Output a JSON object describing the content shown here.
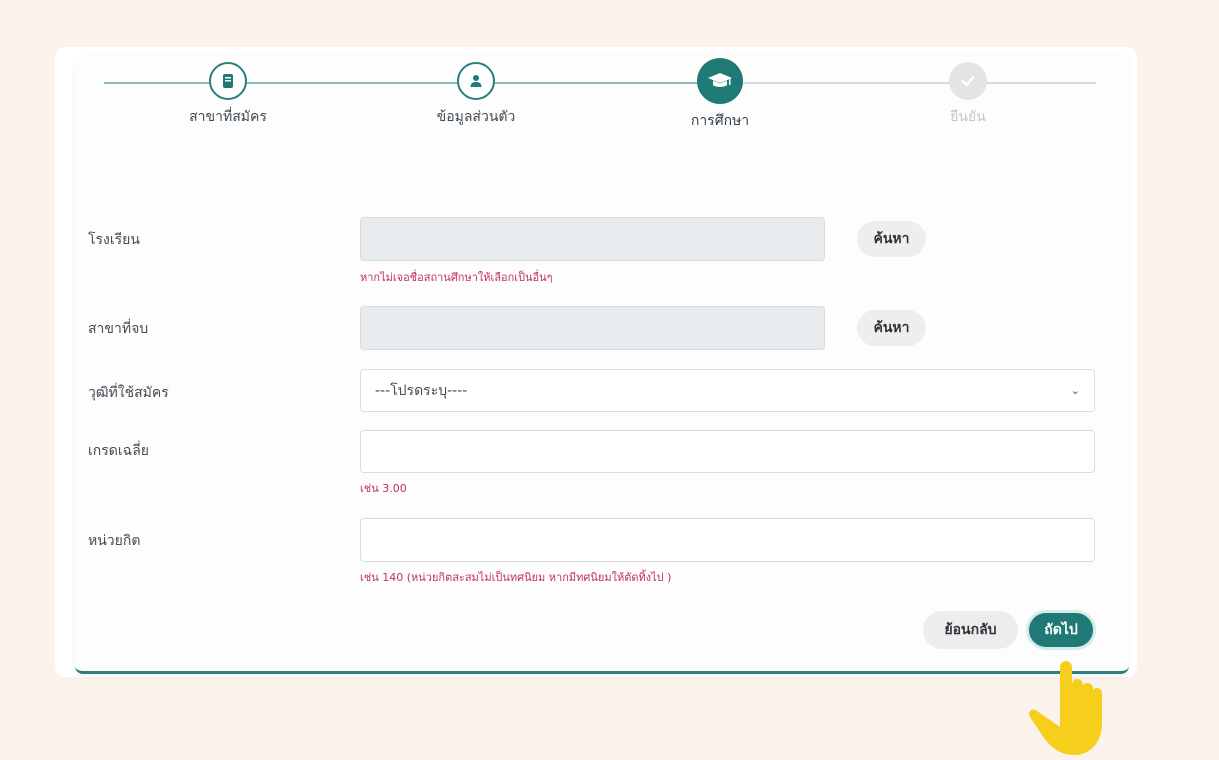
{
  "steps": [
    {
      "label": "สาขาที่สมัคร",
      "icon": "book-icon",
      "state": "done"
    },
    {
      "label": "ข้อมูลส่วนตัว",
      "icon": "user-icon",
      "state": "done"
    },
    {
      "label": "การศึกษา",
      "icon": "graduation-cap-icon",
      "state": "active"
    },
    {
      "label": "ยืนยัน",
      "icon": "check-icon",
      "state": "future"
    }
  ],
  "form": {
    "school": {
      "label": "โรงเรียน",
      "value": "",
      "search_label": "ค้นหา",
      "hint": "หากไม่เจอชื่อสถานศึกษาให้เลือกเป็นอื่นๆ"
    },
    "major": {
      "label": "สาขาที่จบ",
      "value": "",
      "search_label": "ค้นหา"
    },
    "qualification": {
      "label": "วุฒิที่ใช้สมัคร",
      "selected": "---โปรดระบุ----"
    },
    "gpa": {
      "label": "เกรดเฉลี่ย",
      "value": "",
      "hint": "เช่น 3.00"
    },
    "credits": {
      "label": "หน่วยกิต",
      "value": "",
      "hint": "เช่น 140 (หน่วยกิตสะสมไม่เป็นทศนิยม หากมีทศนิยมให้ตัดทิ้งไป )"
    }
  },
  "actions": {
    "back_label": "ย้อนกลับ",
    "next_label": "ถัดไป"
  },
  "colors": {
    "accent": "#1f7a76",
    "hint": "#c2306a",
    "background": "#fbf2eb",
    "pointer": "#f6cf1c"
  }
}
